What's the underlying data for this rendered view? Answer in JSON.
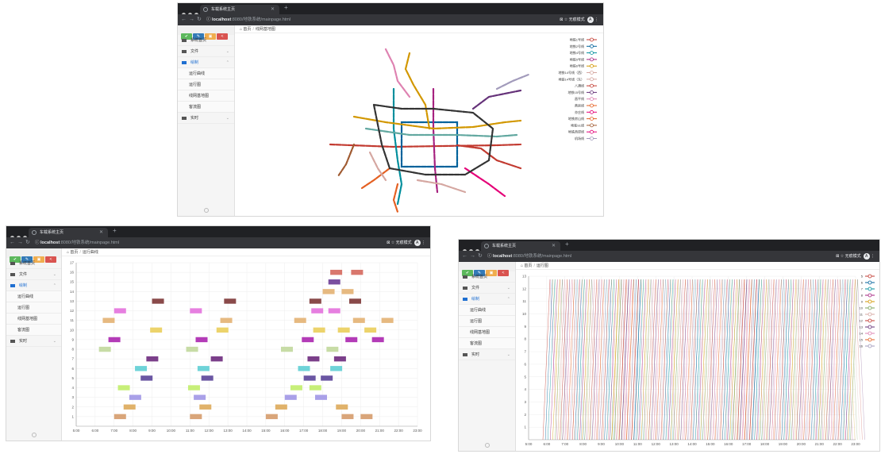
{
  "tab_title": "车载系统主页",
  "url_host": "localhost",
  "url_path": ":8080/地铁系统/mainpage.html",
  "incognito_label": "无痕模式",
  "avatar_letter": "A",
  "sidebar": {
    "buttons": [
      {
        "icon": "check-icon",
        "color": "#5cb85c"
      },
      {
        "icon": "pencil-icon",
        "color": "#337ab7"
      },
      {
        "icon": "users-icon",
        "color": "#f0ad4e"
      },
      {
        "icon": "share-icon",
        "color": "#d9534f"
      }
    ],
    "home": "系统首页",
    "file": "文件",
    "draw": "绘制",
    "sub_items": [
      "运行曲线",
      "运行图",
      "线网基地图",
      "客流图"
    ],
    "realtime": "实时"
  },
  "breadcrumb_home": "首页",
  "windows": {
    "map": {
      "crumb": "线网基地图"
    },
    "runchart": {
      "crumb": "运行曲线"
    },
    "timetable": {
      "crumb": "运行图"
    }
  },
  "map_legend": [
    "地铁1号线",
    "地铁2号线",
    "地铁4号线",
    "地铁5号线",
    "地铁6号线",
    "地铁14号线（西）",
    "地铁14号线（东）",
    "八通线",
    "地铁15号线",
    "昌平线",
    "燕房线",
    "亦庄线",
    "地铁房山线",
    "地铁S1线",
    "地铁西郊线",
    "机场线"
  ],
  "map_colors": [
    "#c23a30",
    "#00629b",
    "#008e9c",
    "#a6217f",
    "#d29700",
    "#d5a7a1",
    "#d5a7a1",
    "#c23a30",
    "#653279",
    "#de82b1",
    "#e46022",
    "#e40077",
    "#e46022",
    "#a05b32",
    "#e40077",
    "#a29bbb"
  ],
  "chart_data": [
    {
      "type": "bar",
      "title": "",
      "x_ticks": [
        "5:00",
        "6:00",
        "7:00",
        "8:00",
        "9:00",
        "10:00",
        "11:00",
        "12:00",
        "13:00",
        "14:00",
        "15:00",
        "16:00",
        "17:00",
        "18:00",
        "19:00",
        "20:00",
        "21:00",
        "22:00",
        "23:00"
      ],
      "y_ticks": [
        "1",
        "2",
        "3",
        "4",
        "5",
        "6",
        "7",
        "8",
        "9",
        "10",
        "11",
        "12",
        "13",
        "14",
        "15",
        "16",
        "17"
      ],
      "level_colors": [
        "#d9a57a",
        "#e0b26a",
        "#a9a0e8",
        "#c7ef79",
        "#6a56a3",
        "#6ed3d8",
        "#7b3f8a",
        "#c7dca6",
        "#b33bb7",
        "#ecd36b",
        "#e67fe0",
        "#8a4a4a",
        "#7a4fa0",
        "#e6b980",
        "#d9776d",
        "#cf5a5a"
      ],
      "bars": [
        [
          1,
          1,
          "#d9a57a"
        ],
        [
          1,
          7,
          "#d9a57a"
        ],
        [
          1,
          11,
          "#d9a57a"
        ],
        [
          1,
          15,
          "#d9a57a"
        ],
        [
          1,
          19,
          "#d9a57a"
        ],
        [
          1,
          20,
          "#d9a57a"
        ],
        [
          2,
          1.3,
          "#e0b26a"
        ],
        [
          2,
          7.5,
          "#e0b26a"
        ],
        [
          2,
          11.5,
          "#e0b26a"
        ],
        [
          2,
          15.5,
          "#e0b26a"
        ],
        [
          2,
          18.7,
          "#e0b26a"
        ],
        [
          3,
          2.1,
          "#a9a0e8"
        ],
        [
          3,
          7.8,
          "#a9a0e8"
        ],
        [
          3,
          11.2,
          "#a9a0e8"
        ],
        [
          3,
          16,
          "#a9a0e8"
        ],
        [
          3,
          17.6,
          "#a9a0e8"
        ],
        [
          4,
          1.7,
          "#c7ef79"
        ],
        [
          4,
          7.2,
          "#c7ef79"
        ],
        [
          4,
          10.9,
          "#c7ef79"
        ],
        [
          4,
          16.3,
          "#c7ef79"
        ],
        [
          4,
          17.3,
          "#c7ef79"
        ],
        [
          5,
          2.6,
          "#6a56a3"
        ],
        [
          5,
          8.4,
          "#6a56a3"
        ],
        [
          5,
          11.6,
          "#6a56a3"
        ],
        [
          5,
          17,
          "#6a56a3"
        ],
        [
          5,
          17.9,
          "#6a56a3"
        ],
        [
          6,
          2.3,
          "#6ed3d8"
        ],
        [
          6,
          8.1,
          "#6ed3d8"
        ],
        [
          6,
          11.4,
          "#6ed3d8"
        ],
        [
          6,
          16.7,
          "#6ed3d8"
        ],
        [
          6,
          18.4,
          "#6ed3d8"
        ],
        [
          7,
          2.9,
          "#7b3f8a"
        ],
        [
          7,
          8.7,
          "#7b3f8a"
        ],
        [
          7,
          12.1,
          "#7b3f8a"
        ],
        [
          7,
          17.2,
          "#7b3f8a"
        ],
        [
          7,
          18.6,
          "#7b3f8a"
        ],
        [
          8,
          1.6,
          "#c7dca6"
        ],
        [
          8,
          6.2,
          "#c7dca6"
        ],
        [
          8,
          10.8,
          "#c7dca6"
        ],
        [
          8,
          15.8,
          "#c7dca6"
        ],
        [
          8,
          18.2,
          "#c7dca6"
        ],
        [
          9,
          1.4,
          "#b33bb7"
        ],
        [
          9,
          6.7,
          "#b33bb7"
        ],
        [
          9,
          11.3,
          "#b33bb7"
        ],
        [
          9,
          16.9,
          "#b33bb7"
        ],
        [
          9,
          19.2,
          "#b33bb7"
        ],
        [
          9,
          20.6,
          "#b33bb7"
        ],
        [
          10,
          2.0,
          "#ecd36b"
        ],
        [
          10,
          8.9,
          "#ecd36b"
        ],
        [
          10,
          12.4,
          "#ecd36b"
        ],
        [
          10,
          17.5,
          "#ecd36b"
        ],
        [
          10,
          18.8,
          "#ecd36b"
        ],
        [
          10,
          20.2,
          "#ecd36b"
        ],
        [
          11,
          1.8,
          "#e6b980"
        ],
        [
          11,
          6.4,
          "#e6b980"
        ],
        [
          11,
          12.6,
          "#e6b980"
        ],
        [
          11,
          16.5,
          "#e6b980"
        ],
        [
          11,
          19.6,
          "#e6b980"
        ],
        [
          11,
          21.1,
          "#e6b980"
        ],
        [
          12,
          2.5,
          "#e67fe0"
        ],
        [
          12,
          7.0,
          "#e67fe0"
        ],
        [
          12,
          11.0,
          "#e67fe0"
        ],
        [
          12,
          17.4,
          "#e67fe0"
        ],
        [
          12,
          18.3,
          "#e67fe0"
        ],
        [
          13,
          2.2,
          "#8a4a4a"
        ],
        [
          13,
          9.0,
          "#8a4a4a"
        ],
        [
          13,
          12.8,
          "#8a4a4a"
        ],
        [
          13,
          17.3,
          "#8a4a4a"
        ],
        [
          13,
          19.4,
          "#8a4a4a"
        ],
        [
          14,
          18.0,
          "#e6b980"
        ],
        [
          14,
          19.0,
          "#e6b980"
        ],
        [
          15,
          18.3,
          "#7a4fa0"
        ],
        [
          16,
          18.4,
          "#d9776d"
        ],
        [
          16,
          19.5,
          "#d9776d"
        ]
      ]
    },
    {
      "type": "line",
      "title": "",
      "x_ticks": [
        "5:00",
        "6:00",
        "7:00",
        "8:00",
        "9:00",
        "10:00",
        "11:00",
        "12:00",
        "13:00",
        "14:00",
        "15:00",
        "16:00",
        "17:00",
        "18:00",
        "19:00",
        "20:00",
        "21:00",
        "22:00",
        "23:00"
      ],
      "y_ticks": [
        "1",
        "2",
        "3",
        "4",
        "5",
        "6",
        "7",
        "8",
        "9",
        "10",
        "11",
        "12",
        "13"
      ],
      "legend": [
        "5",
        "6",
        "7",
        "8",
        "9",
        "10",
        "11",
        "12",
        "13",
        "14",
        "15",
        "16"
      ],
      "legend_colors": [
        "#c23a30",
        "#00629b",
        "#008e9c",
        "#a6217f",
        "#d29700",
        "#7aa35a",
        "#d5a7a1",
        "#c23a30",
        "#653279",
        "#de82b1",
        "#e46022",
        "#a29bbb"
      ]
    }
  ]
}
